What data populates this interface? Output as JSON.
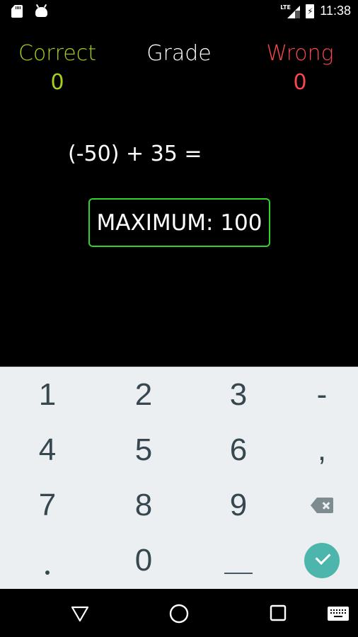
{
  "status_bar": {
    "left_icons": [
      "sd-card-icon",
      "android-debug-icon"
    ],
    "network_label": "LTE",
    "battery_state": "charging",
    "time": "11:38"
  },
  "scoreboard": {
    "correct_label": "Correct",
    "correct_value": "0",
    "grade_label": "Grade",
    "grade_value": "",
    "wrong_label": "Wrong",
    "wrong_value": "0",
    "colors": {
      "correct": "#a5cf1c",
      "grade": "#ffffff",
      "wrong": "#f4484a"
    }
  },
  "problem": {
    "expression": "(-50) + 35 ="
  },
  "answer": {
    "placeholder": "MAXIMUM: 100",
    "value": "",
    "border_color": "#2fd32b"
  },
  "keyboard": {
    "rows": [
      [
        "1",
        "2",
        "3",
        "-"
      ],
      [
        "4",
        "5",
        "6",
        ","
      ],
      [
        "7",
        "8",
        "9",
        "backspace"
      ],
      [
        ".",
        "0",
        "space",
        "done"
      ]
    ],
    "accent_color": "#4db6ac"
  },
  "nav_bar": {
    "buttons": [
      "back-icon",
      "home-icon",
      "recents-icon",
      "keyboard-switch-icon"
    ]
  }
}
